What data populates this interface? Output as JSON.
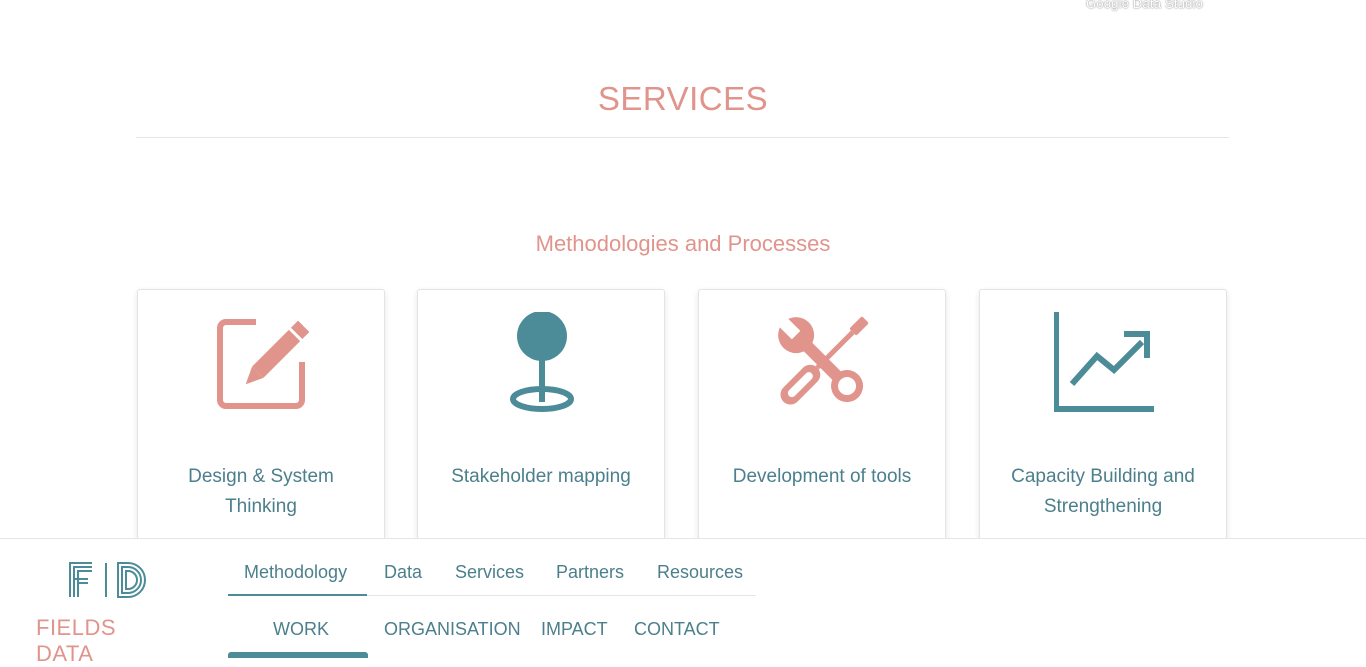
{
  "watermark": "Google Data Studio",
  "section": {
    "title": "SERVICES",
    "subtitle": "Methodologies and Processes"
  },
  "cards": [
    {
      "label": "Design & System Thinking",
      "icon": "edit-icon",
      "color": "#e0948b"
    },
    {
      "label": "Stakeholder mapping",
      "icon": "map-pin-icon",
      "color": "#4b8c98"
    },
    {
      "label": "Development of tools",
      "icon": "tools-icon",
      "color": "#e0948b"
    },
    {
      "label": "Capacity Building and Strengthening",
      "icon": "chart-up-icon",
      "color": "#4b8c98"
    }
  ],
  "footer": {
    "logo_text": "FIELDS DATA",
    "menu_top": [
      "Methodology",
      "Data",
      "Services",
      "Partners",
      "Resources"
    ],
    "menu_bottom": [
      "WORK",
      "ORGANISATION",
      "IMPACT",
      "CONTACT"
    ],
    "active_top": "Methodology",
    "active_bottom": "WORK"
  },
  "colors": {
    "accent_pink": "#e0948b",
    "accent_teal": "#4b8c98",
    "text_teal": "#4b7f8c"
  }
}
